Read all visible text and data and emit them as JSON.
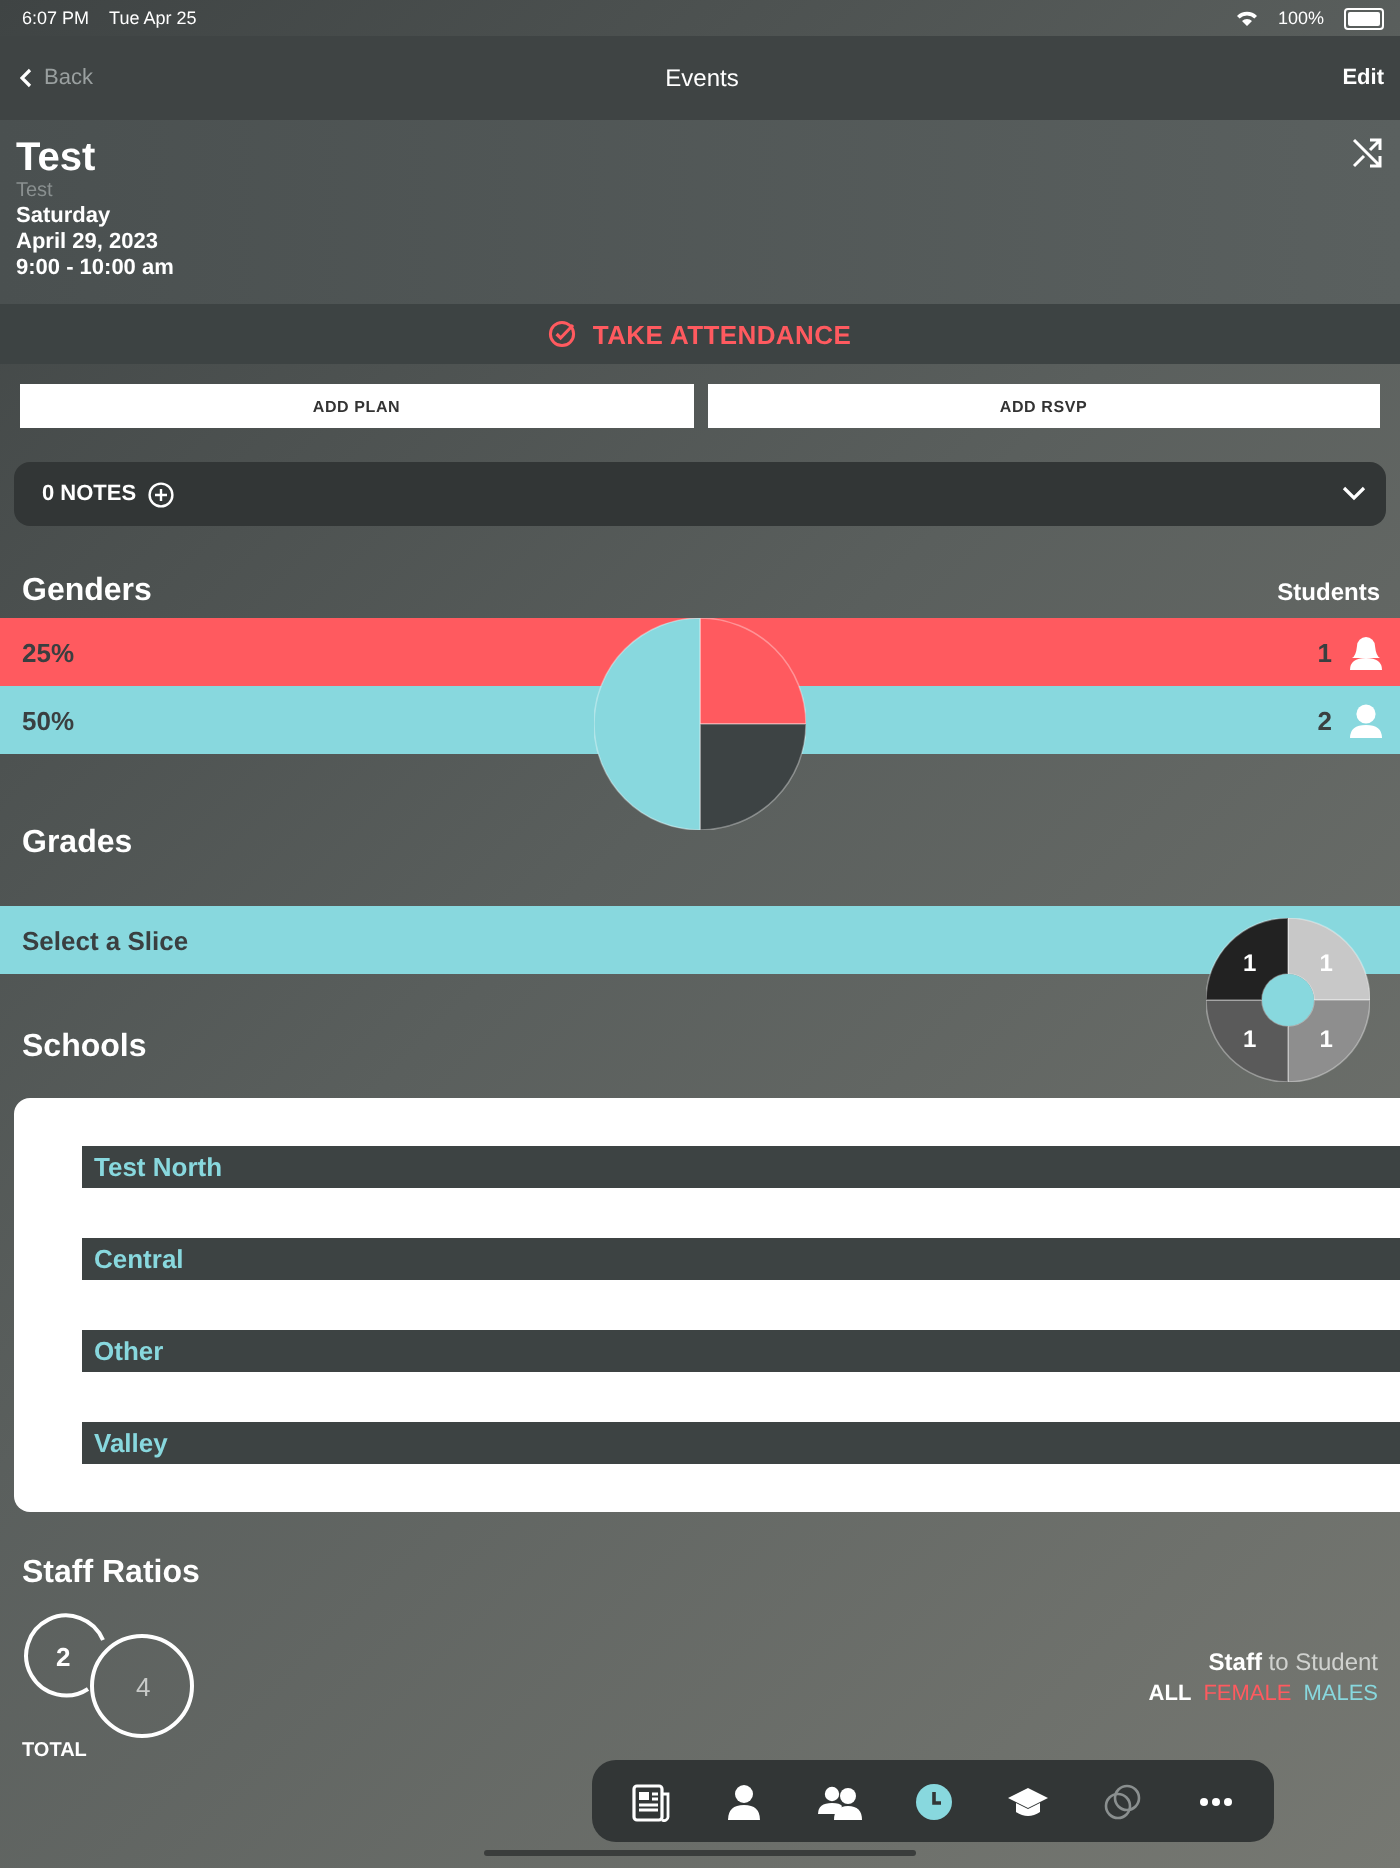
{
  "status_bar": {
    "time": "6:07 PM",
    "date": "Tue Apr 25",
    "battery": "100%"
  },
  "nav": {
    "back": "Back",
    "title": "Events",
    "edit": "Edit"
  },
  "event": {
    "title": "Test",
    "subtitle": "Test",
    "day": "Saturday",
    "date": "April 29, 2023",
    "time": "9:00 - 10:00 am"
  },
  "attendance": {
    "label": "TAKE ATTENDANCE"
  },
  "buttons": [
    "ADD PLAN",
    "ADD RSVP"
  ],
  "notes": {
    "label": "0 NOTES",
    "expanded": false
  },
  "genders": {
    "title": "Genders",
    "column": "Students",
    "rows": [
      {
        "share": "25%",
        "count": "1",
        "color": "#ff5a5f",
        "kind": "female"
      },
      {
        "share": "50%",
        "count": "2",
        "color": "#88d8de",
        "kind": "male"
      }
    ],
    "chart_data": {
      "type": "pie",
      "values": [
        25,
        25,
        50
      ]
    }
  },
  "grades": {
    "title": "Grades",
    "prompt": "Select a Slice",
    "chart_data": {
      "type": "donut",
      "data_labels": true,
      "values": [
        1,
        1,
        1,
        1
      ]
    }
  },
  "schools": {
    "title": "Schools",
    "items": [
      "Test North",
      "Central",
      "Other",
      "Valley"
    ]
  },
  "staff_ratios": {
    "title": "Staff Ratios",
    "staff": "2",
    "students": "4",
    "total_label": "TOTAL",
    "ratio_label": "**Staff** to Student",
    "filters": [
      {
        "label": "ALL",
        "selected": true,
        "color": "#ffffff"
      },
      {
        "label": "FEMALE",
        "selected": false,
        "color": "#ff5a5f"
      },
      {
        "label": "MALES",
        "selected": false,
        "color": "#88d8de"
      }
    ]
  },
  "tab_bar": [
    {
      "kind": "news",
      "selected": false
    },
    {
      "kind": "person",
      "selected": false
    },
    {
      "kind": "people",
      "selected": false
    },
    {
      "kind": "clock",
      "selected": true
    },
    {
      "kind": "cap",
      "selected": false
    },
    {
      "kind": "rings",
      "selected": false
    },
    {
      "kind": "more",
      "selected": false
    }
  ]
}
